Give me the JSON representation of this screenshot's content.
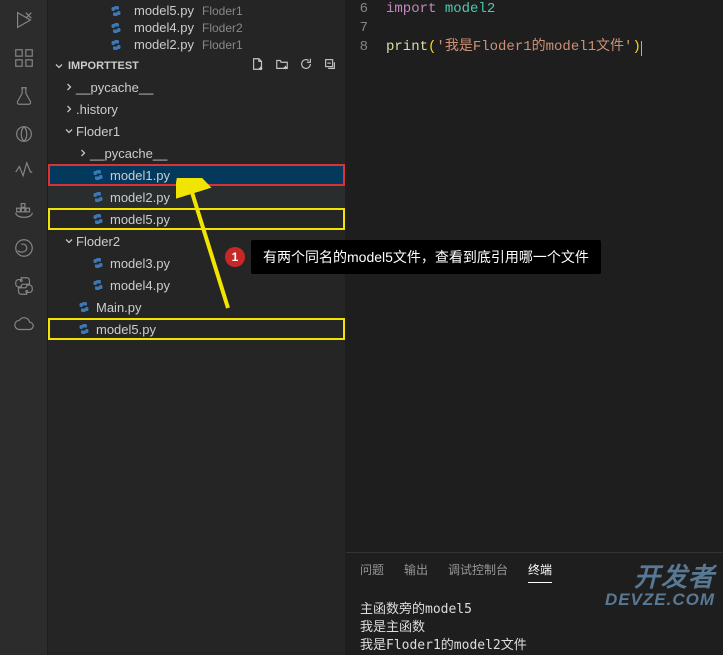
{
  "openEditors": [
    {
      "name": "model5.py",
      "meta": "Floder1"
    },
    {
      "name": "model4.py",
      "meta": "Floder2"
    },
    {
      "name": "model2.py",
      "meta": "Floder1"
    }
  ],
  "projectName": "IMPORTTEST",
  "tree": [
    {
      "kind": "folder",
      "label": "__pycache__",
      "depth": 0,
      "chev": "right"
    },
    {
      "kind": "folder",
      "label": ".history",
      "depth": 0,
      "chev": "right"
    },
    {
      "kind": "folder",
      "label": "Floder1",
      "depth": 0,
      "chev": "down"
    },
    {
      "kind": "folder",
      "label": "__pycache__",
      "depth": 1,
      "chev": "right"
    },
    {
      "kind": "file",
      "label": "model1.py",
      "depth": 1,
      "hl": "red",
      "state": "selected"
    },
    {
      "kind": "file",
      "label": "model2.py",
      "depth": 1,
      "state": "hover"
    },
    {
      "kind": "file",
      "label": "model5.py",
      "depth": 1,
      "hl": "yellow"
    },
    {
      "kind": "folder",
      "label": "Floder2",
      "depth": 0,
      "chev": "down"
    },
    {
      "kind": "file",
      "label": "model3.py",
      "depth": 1
    },
    {
      "kind": "file",
      "label": "model4.py",
      "depth": 1
    },
    {
      "kind": "file",
      "label": "Main.py",
      "depth": 0
    },
    {
      "kind": "file",
      "label": "model5.py",
      "depth": 0,
      "hl": "yellow"
    }
  ],
  "code": {
    "lines": [
      {
        "n": 6,
        "seg": [
          [
            "import",
            "tok-import"
          ],
          [
            " ",
            ""
          ],
          [
            "model2",
            "tok-mod"
          ]
        ]
      },
      {
        "n": 7,
        "seg": []
      },
      {
        "n": 8,
        "seg": [
          [
            "print",
            "tok-func"
          ],
          [
            "(",
            "tok-br"
          ],
          [
            "'我是Floder1的model1文件'",
            "tok-str"
          ],
          [
            ")",
            "tok-br"
          ]
        ],
        "cursor": true
      }
    ]
  },
  "panel": {
    "tabs": [
      "问题",
      "输出",
      "调试控制台",
      "终端"
    ],
    "active": 3,
    "terminal": [
      "主函数旁的model5",
      "我是主函数",
      "我是Floder1的model2文件"
    ]
  },
  "callout": {
    "num": "1",
    "text": "有两个同名的model5文件，查看到底引用哪一个文件"
  },
  "watermark": [
    "开发者",
    "DEVZE.COM"
  ]
}
